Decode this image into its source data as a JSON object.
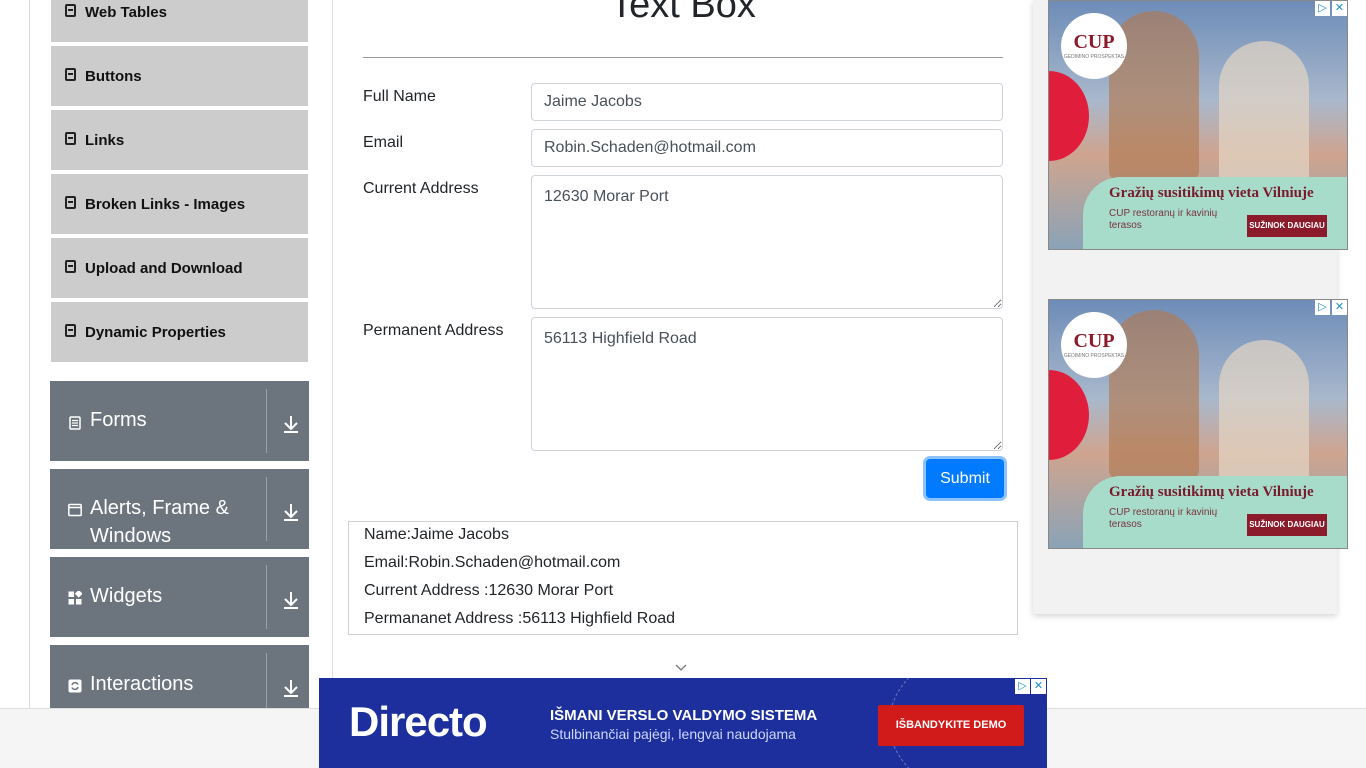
{
  "sidebar": {
    "element_items": [
      {
        "label": "Web Tables",
        "icon": "list-icon"
      },
      {
        "label": "Buttons",
        "icon": "list-icon"
      },
      {
        "label": "Links",
        "icon": "list-icon"
      },
      {
        "label": "Broken Links - Images",
        "icon": "list-icon"
      },
      {
        "label": "Upload and Download",
        "icon": "list-icon"
      },
      {
        "label": "Dynamic Properties",
        "icon": "list-icon"
      }
    ],
    "groups": [
      {
        "label": "Forms",
        "icon": "document-icon"
      },
      {
        "label": "Alerts, Frame & Windows",
        "icon": "window-icon"
      },
      {
        "label": "Widgets",
        "icon": "widgets-icon"
      },
      {
        "label": "Interactions",
        "icon": "refresh-icon"
      }
    ]
  },
  "form": {
    "title": "Text Box",
    "full_name_label": "Full Name",
    "full_name_value": "Jaime Jacobs",
    "email_label": "Email",
    "email_value": "Robin.Schaden@hotmail.com",
    "current_address_label": "Current Address",
    "current_address_value": "12630 Morar Port",
    "permanent_address_label": "Permanent Address",
    "permanent_address_value": "56113 Highfield Road",
    "submit_label": "Submit"
  },
  "output": {
    "name_line": "Name:Jaime Jacobs",
    "email_line": "Email:Robin.Schaden@hotmail.com",
    "current_address_line": "Current Address :12630 Morar Port",
    "permanent_address_line": "Permananet Address :56113 Highfield Road"
  },
  "ads": {
    "side": {
      "logo": "CUP",
      "logo_sub": "GEDIMINO PROSPEKTAS",
      "headline": "Gražių susitikimų vieta Vilniuje",
      "sub": "CUP restoranų ir kavinių terasos",
      "cta": "SUŽINOK DAUGIAU",
      "adchoice_play": "▷",
      "adchoice_close": "✕"
    },
    "banner": {
      "logo": "Directo",
      "headline": "IŠMANI VERSLO VALDYMO SISTEMA",
      "sub": "Stulbinančiai pajėgi, lengvai naudojama",
      "cta": "IŠBANDYKITE DEMO",
      "adchoice_play": "▷",
      "adchoice_close": "✕"
    }
  },
  "colors": {
    "primary": "#007bff",
    "group_bg": "#6c757d",
    "menu_item_bg": "#cccccc",
    "banner_bg": "#1c2f9c"
  }
}
